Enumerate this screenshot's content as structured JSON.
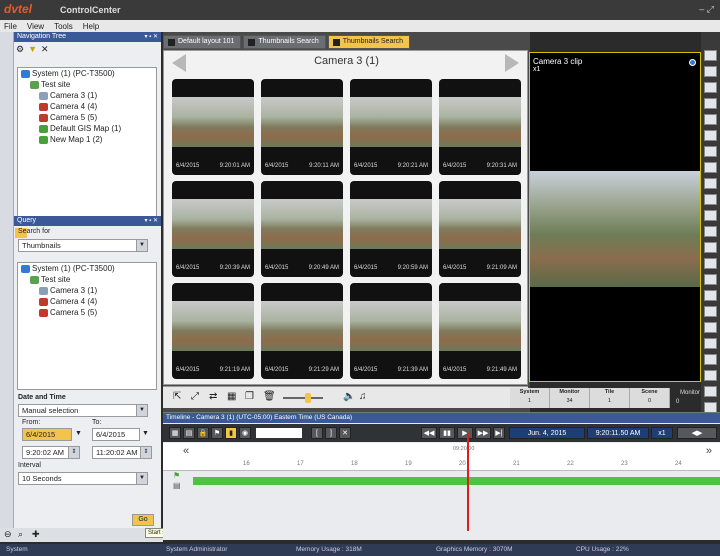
{
  "app": {
    "logo": "dvtel",
    "title": "ControlCenter",
    "window_controls": "– ⤢"
  },
  "menu": [
    "File",
    "View",
    "Tools",
    "Help"
  ],
  "nav_tree": {
    "header": "Navigation Tree",
    "items": [
      {
        "label": "System (1) (PC-T3500)",
        "icon": "system-icon",
        "color": "#2f7bd6",
        "indent": 0
      },
      {
        "label": "Test site",
        "icon": "site-icon",
        "color": "#5aa04e",
        "indent": 1
      },
      {
        "label": "Camera 3 (1)",
        "icon": "camera-icon",
        "color": "#8aa0b8",
        "indent": 2
      },
      {
        "label": "Camera 4 (4)",
        "icon": "camera-icon",
        "color": "#c0392b",
        "indent": 2
      },
      {
        "label": "Camera 5 (5)",
        "icon": "camera-icon",
        "color": "#c0392b",
        "indent": 2
      },
      {
        "label": "Default GIS Map (1)",
        "icon": "map-icon",
        "color": "#48a03a",
        "indent": 2
      },
      {
        "label": "New Map 1 (2)",
        "icon": "map-icon",
        "color": "#48a03a",
        "indent": 2
      }
    ]
  },
  "query": {
    "header": "Query",
    "search_for_label": "Search for",
    "search_for_value": "Thumbnails",
    "items": [
      {
        "label": "System (1) (PC-T3500)",
        "color": "#2f7bd6",
        "indent": 0
      },
      {
        "label": "Test site",
        "color": "#5aa04e",
        "indent": 1
      },
      {
        "label": "Camera 3 (1)",
        "color": "#8aa0b8",
        "indent": 2
      },
      {
        "label": "Camera 4 (4)",
        "color": "#c0392b",
        "indent": 2
      },
      {
        "label": "Camera 5 (5)",
        "color": "#c0392b",
        "indent": 2
      }
    ],
    "date_time_label": "Date and Time",
    "date_mode": "Manual selection",
    "from_label": "From:",
    "to_label": "To:",
    "from_date": "6/4/2015",
    "to_date": "6/4/2015",
    "from_time": "9:20:02 AM",
    "to_time": "11:20:02 AM",
    "interval_label": "Interval",
    "interval_value": "10 Seconds",
    "go_label": "Go",
    "tooltip": "Start search"
  },
  "tabs": [
    {
      "label": "Default layout 101",
      "active": false
    },
    {
      "label": "Thumbnails Search",
      "active": false
    },
    {
      "label": "Thumbnails Search",
      "active": true
    }
  ],
  "thumbs": {
    "title": "Camera 3 (1)",
    "items": [
      {
        "date": "6/4/2015",
        "time": "9:20:01 AM"
      },
      {
        "date": "6/4/2015",
        "time": "9:20:11 AM"
      },
      {
        "date": "6/4/2015",
        "time": "9:20:21 AM"
      },
      {
        "date": "6/4/2015",
        "time": "9:20:31 AM"
      },
      {
        "date": "6/4/2015",
        "time": "9:20:39 AM"
      },
      {
        "date": "6/4/2015",
        "time": "9:20:49 AM"
      },
      {
        "date": "6/4/2015",
        "time": "9:20:59 AM"
      },
      {
        "date": "6/4/2015",
        "time": "9:21:09 AM"
      },
      {
        "date": "6/4/2015",
        "time": "9:21:19 AM"
      },
      {
        "date": "6/4/2015",
        "time": "9:21:29 AM"
      },
      {
        "date": "6/4/2015",
        "time": "9:21:39 AM"
      },
      {
        "date": "6/4/2015",
        "time": "9:21:49 AM"
      }
    ]
  },
  "clip": {
    "name": "Camera 3 clip",
    "zoom": "x1"
  },
  "stats": [
    {
      "label": "System",
      "value": "1"
    },
    {
      "label": "Monitor",
      "value": "34"
    },
    {
      "label": "Tile",
      "value": "1"
    },
    {
      "label": "Scene",
      "value": "0"
    }
  ],
  "monitor_value": "0",
  "monitor_label": "Monitor",
  "timeline": {
    "header": "Timeline - Camera 3 (1) (UTC-05:00) Eastern Time (US Canada)",
    "date": "Jun. 4, 2015",
    "time": "9:20:11.50 AM",
    "speed": "x1",
    "playhead_label": "09:20:00",
    "ticks": [
      "16",
      "17",
      "18",
      "19",
      "20",
      "21",
      "22",
      "23",
      "24"
    ]
  },
  "status": {
    "system": "System",
    "user": "System Administrator",
    "memory": "Memory Usage : 318M",
    "graphics": "Graphics Memory : 3070M",
    "cpu": "CPU Usage : 22%"
  }
}
